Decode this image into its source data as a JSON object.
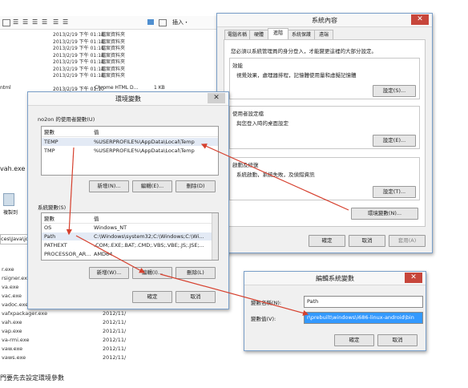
{
  "explorer": {
    "toolbar_insert": "插入・",
    "top_rows": [
      {
        "date": "2013/2/19 下午 01:12",
        "type": "檔案資料夾"
      },
      {
        "date": "2013/2/19 下午 01:12",
        "type": "檔案資料夾"
      },
      {
        "date": "2013/2/19 下午 01:11",
        "type": "檔案資料夾"
      },
      {
        "date": "2013/2/19 下午 01:12",
        "type": "檔案資料夾"
      },
      {
        "date": "2013/2/19 下午 01:12",
        "type": "檔案資料夾"
      },
      {
        "date": "2013/2/19 下午 01:12",
        "type": "檔案資料夾"
      },
      {
        "date": "2013/2/19 下午 01:12",
        "type": "檔案資料夾"
      }
    ],
    "html_row": {
      "name": "ntml",
      "date": "2013/2/19 下午 01:10",
      "type": "Chrome HTML D...",
      "size": "1 KB"
    },
    "mid_text": "vah.exe 路",
    "lib_label": "複製到",
    "path_fragment": "ces\\Java\\jd",
    "bottom_files": [
      {
        "name": "r.exe",
        "date": ""
      },
      {
        "name": "rsigner.exe",
        "date": "2012/11/"
      },
      {
        "name": "va.exe",
        "date": "2012/11/"
      },
      {
        "name": "vac.exe",
        "date": "2012/11/"
      },
      {
        "name": "vadoc.exe",
        "date": "2012/11/"
      },
      {
        "name": "vafxpackager.exe",
        "date": "2012/11/"
      },
      {
        "name": "vah.exe",
        "date": "2012/11/"
      },
      {
        "name": "vap.exe",
        "date": "2012/11/"
      },
      {
        "name": "va-rmi.exe",
        "date": "2012/11/"
      },
      {
        "name": "vaw.exe",
        "date": "2012/11/"
      },
      {
        "name": "vaws.exe",
        "date": "2012/11/"
      }
    ],
    "caption": "門要先去設定環境參數"
  },
  "sysprops": {
    "title": "系統內容",
    "close": "✕",
    "tabs": [
      "電腦名稱",
      "硬體",
      "進階",
      "系統保護",
      "遠端"
    ],
    "intro": "您必須以系統管理員的身分登入，才能變更這裡的大部分設定。",
    "perf_title": "效能",
    "perf_text": "視覺效果，處理器排程，記憶體使用量和虛擬記憶體",
    "perf_btn": "設定(S)...",
    "profile_title": "使用者設定檔",
    "profile_text": "與您登入時的桌面設定",
    "profile_btn": "設定(E)...",
    "startup_title": "啟動及修復",
    "startup_text": "系統啟動，系統失敗，及偵錯資訊",
    "startup_btn": "設定(T)...",
    "env_btn": "環境變數(N)...",
    "ok": "確定",
    "cancel": "取消",
    "apply": "套用(A)"
  },
  "envvars": {
    "title": "環境變數",
    "close": "✕",
    "user_group": "no2on 的使用者變數(U)",
    "col_var": "變數",
    "col_val": "值",
    "user_rows": [
      {
        "name": "TEMP",
        "value": "%USERPROFILE%\\AppData\\Local\\Temp"
      },
      {
        "name": "TMP",
        "value": "%USERPROFILE%\\AppData\\Local\\Temp"
      }
    ],
    "user_new": "新增(N)...",
    "user_edit": "編輯(E)...",
    "user_delete": "刪除(D)",
    "sys_group": "系統變數(S)",
    "sys_rows": [
      {
        "name": "OS",
        "value": "Windows_NT"
      },
      {
        "name": "Path",
        "value": "C:\\Windows\\system32;C:\\Windows;C:\\Wi..."
      },
      {
        "name": "PATHEXT",
        "value": ".COM;.EXE;.BAT;.CMD;.VBS;.VBE;.JS;.JSE;..."
      },
      {
        "name": "PROCESSOR_AR...",
        "value": "AMD64"
      }
    ],
    "sys_new": "新增(W)...",
    "sys_edit": "編輯(I)...",
    "sys_delete": "刪除(L)",
    "ok": "確定",
    "cancel": "取消"
  },
  "editvar": {
    "title": "編輯系統變數",
    "close": "✕",
    "name_label": "變數名稱(N):",
    "name_value": "Path",
    "value_label": "變數值(V):",
    "value_value": "r\\prebuilt\\windows\\i686-linux-android\\bin",
    "ok": "確定",
    "cancel": "取消"
  },
  "colors": {
    "arrow": "#d6402e",
    "selection": "#3399ff",
    "close_button": "#c7463b"
  }
}
